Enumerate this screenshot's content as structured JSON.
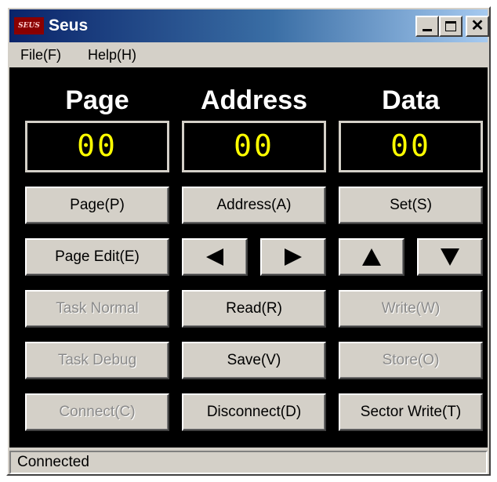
{
  "window": {
    "title": "Seus",
    "icon_text": "SEUS"
  },
  "menu": [
    {
      "label": "File(F)"
    },
    {
      "label": "Help(H)"
    }
  ],
  "columns": {
    "page": {
      "heading": "Page",
      "value": "00"
    },
    "address": {
      "heading": "Address",
      "value": "00"
    },
    "data": {
      "heading": "Data",
      "value": "00"
    }
  },
  "buttons": {
    "page": "Page(P)",
    "address": "Address(A)",
    "set": "Set(S)",
    "page_edit": "Page Edit(E)",
    "task_normal": "Task Normal",
    "read": "Read(R)",
    "write": "Write(W)",
    "task_debug": "Task Debug",
    "save": "Save(V)",
    "store": "Store(O)",
    "connect": "Connect(C)",
    "disconnect": "Disconnect(D)",
    "sector_write": "Sector Write(T)"
  },
  "disabled_buttons": [
    "task_normal",
    "write",
    "task_debug",
    "store",
    "connect"
  ],
  "status": {
    "text": "Connected"
  },
  "colors": {
    "display_text": "#ffff00",
    "panel_background": "#000000",
    "face": "#d4d0c8",
    "title_gradient_start": "#0a246a"
  }
}
